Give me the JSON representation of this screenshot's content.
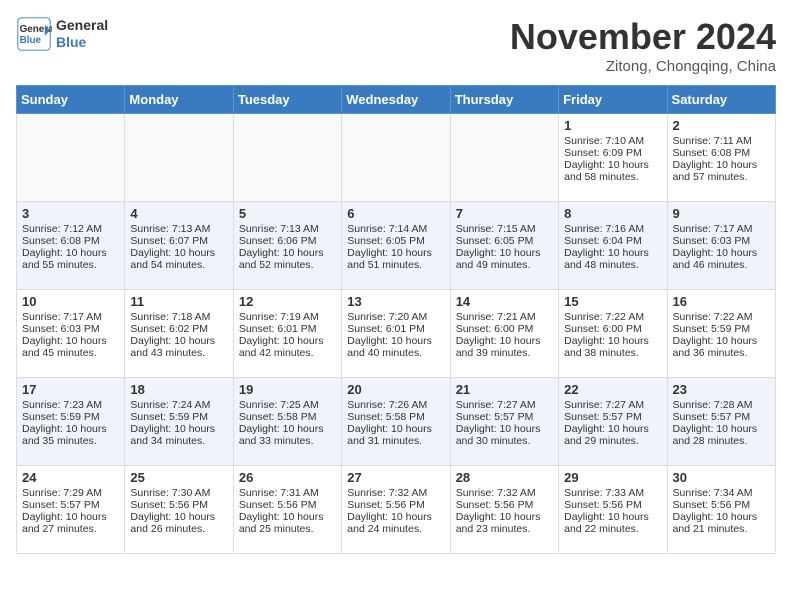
{
  "header": {
    "logo_line1": "General",
    "logo_line2": "Blue",
    "month": "November 2024",
    "location": "Zitong, Chongqing, China"
  },
  "weekdays": [
    "Sunday",
    "Monday",
    "Tuesday",
    "Wednesday",
    "Thursday",
    "Friday",
    "Saturday"
  ],
  "weeks": [
    [
      {
        "day": "",
        "info": ""
      },
      {
        "day": "",
        "info": ""
      },
      {
        "day": "",
        "info": ""
      },
      {
        "day": "",
        "info": ""
      },
      {
        "day": "",
        "info": ""
      },
      {
        "day": "1",
        "info": "Sunrise: 7:10 AM\nSunset: 6:09 PM\nDaylight: 10 hours and 58 minutes."
      },
      {
        "day": "2",
        "info": "Sunrise: 7:11 AM\nSunset: 6:08 PM\nDaylight: 10 hours and 57 minutes."
      }
    ],
    [
      {
        "day": "3",
        "info": "Sunrise: 7:12 AM\nSunset: 6:08 PM\nDaylight: 10 hours and 55 minutes."
      },
      {
        "day": "4",
        "info": "Sunrise: 7:13 AM\nSunset: 6:07 PM\nDaylight: 10 hours and 54 minutes."
      },
      {
        "day": "5",
        "info": "Sunrise: 7:13 AM\nSunset: 6:06 PM\nDaylight: 10 hours and 52 minutes."
      },
      {
        "day": "6",
        "info": "Sunrise: 7:14 AM\nSunset: 6:05 PM\nDaylight: 10 hours and 51 minutes."
      },
      {
        "day": "7",
        "info": "Sunrise: 7:15 AM\nSunset: 6:05 PM\nDaylight: 10 hours and 49 minutes."
      },
      {
        "day": "8",
        "info": "Sunrise: 7:16 AM\nSunset: 6:04 PM\nDaylight: 10 hours and 48 minutes."
      },
      {
        "day": "9",
        "info": "Sunrise: 7:17 AM\nSunset: 6:03 PM\nDaylight: 10 hours and 46 minutes."
      }
    ],
    [
      {
        "day": "10",
        "info": "Sunrise: 7:17 AM\nSunset: 6:03 PM\nDaylight: 10 hours and 45 minutes."
      },
      {
        "day": "11",
        "info": "Sunrise: 7:18 AM\nSunset: 6:02 PM\nDaylight: 10 hours and 43 minutes."
      },
      {
        "day": "12",
        "info": "Sunrise: 7:19 AM\nSunset: 6:01 PM\nDaylight: 10 hours and 42 minutes."
      },
      {
        "day": "13",
        "info": "Sunrise: 7:20 AM\nSunset: 6:01 PM\nDaylight: 10 hours and 40 minutes."
      },
      {
        "day": "14",
        "info": "Sunrise: 7:21 AM\nSunset: 6:00 PM\nDaylight: 10 hours and 39 minutes."
      },
      {
        "day": "15",
        "info": "Sunrise: 7:22 AM\nSunset: 6:00 PM\nDaylight: 10 hours and 38 minutes."
      },
      {
        "day": "16",
        "info": "Sunrise: 7:22 AM\nSunset: 5:59 PM\nDaylight: 10 hours and 36 minutes."
      }
    ],
    [
      {
        "day": "17",
        "info": "Sunrise: 7:23 AM\nSunset: 5:59 PM\nDaylight: 10 hours and 35 minutes."
      },
      {
        "day": "18",
        "info": "Sunrise: 7:24 AM\nSunset: 5:59 PM\nDaylight: 10 hours and 34 minutes."
      },
      {
        "day": "19",
        "info": "Sunrise: 7:25 AM\nSunset: 5:58 PM\nDaylight: 10 hours and 33 minutes."
      },
      {
        "day": "20",
        "info": "Sunrise: 7:26 AM\nSunset: 5:58 PM\nDaylight: 10 hours and 31 minutes."
      },
      {
        "day": "21",
        "info": "Sunrise: 7:27 AM\nSunset: 5:57 PM\nDaylight: 10 hours and 30 minutes."
      },
      {
        "day": "22",
        "info": "Sunrise: 7:27 AM\nSunset: 5:57 PM\nDaylight: 10 hours and 29 minutes."
      },
      {
        "day": "23",
        "info": "Sunrise: 7:28 AM\nSunset: 5:57 PM\nDaylight: 10 hours and 28 minutes."
      }
    ],
    [
      {
        "day": "24",
        "info": "Sunrise: 7:29 AM\nSunset: 5:57 PM\nDaylight: 10 hours and 27 minutes."
      },
      {
        "day": "25",
        "info": "Sunrise: 7:30 AM\nSunset: 5:56 PM\nDaylight: 10 hours and 26 minutes."
      },
      {
        "day": "26",
        "info": "Sunrise: 7:31 AM\nSunset: 5:56 PM\nDaylight: 10 hours and 25 minutes."
      },
      {
        "day": "27",
        "info": "Sunrise: 7:32 AM\nSunset: 5:56 PM\nDaylight: 10 hours and 24 minutes."
      },
      {
        "day": "28",
        "info": "Sunrise: 7:32 AM\nSunset: 5:56 PM\nDaylight: 10 hours and 23 minutes."
      },
      {
        "day": "29",
        "info": "Sunrise: 7:33 AM\nSunset: 5:56 PM\nDaylight: 10 hours and 22 minutes."
      },
      {
        "day": "30",
        "info": "Sunrise: 7:34 AM\nSunset: 5:56 PM\nDaylight: 10 hours and 21 minutes."
      }
    ]
  ]
}
